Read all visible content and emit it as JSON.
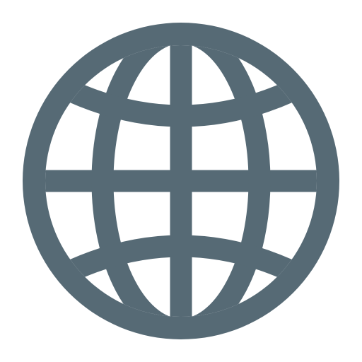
{
  "icon": {
    "name": "globe-icon",
    "color": "#566a75",
    "background": "#ffffff"
  }
}
